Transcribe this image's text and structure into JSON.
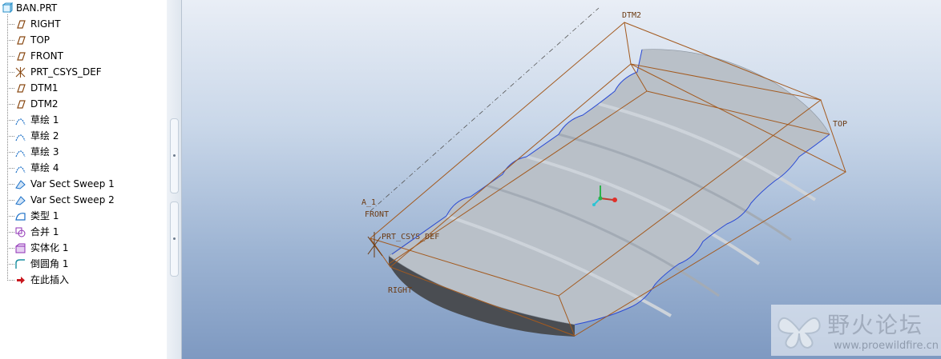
{
  "model_tree": {
    "root": "BAN.PRT",
    "items": [
      {
        "label": "RIGHT",
        "icon": "datum-plane-icon"
      },
      {
        "label": "TOP",
        "icon": "datum-plane-icon"
      },
      {
        "label": "FRONT",
        "icon": "datum-plane-icon"
      },
      {
        "label": "PRT_CSYS_DEF",
        "icon": "coordinate-system-icon"
      },
      {
        "label": "DTM1",
        "icon": "datum-plane-icon"
      },
      {
        "label": "DTM2",
        "icon": "datum-plane-icon"
      },
      {
        "label": "草绘 1",
        "icon": "sketch-icon"
      },
      {
        "label": "草绘 2",
        "icon": "sketch-icon"
      },
      {
        "label": "草绘 3",
        "icon": "sketch-icon"
      },
      {
        "label": "草绘 4",
        "icon": "sketch-icon"
      },
      {
        "label": "Var Sect Sweep 1",
        "icon": "sweep-icon"
      },
      {
        "label": "Var Sect Sweep 2",
        "icon": "sweep-icon"
      },
      {
        "label": "类型 1",
        "icon": "style-icon"
      },
      {
        "label": "合并 1",
        "icon": "merge-icon"
      },
      {
        "label": "实体化 1",
        "icon": "solidify-icon"
      },
      {
        "label": "倒圆角 1",
        "icon": "round-icon"
      },
      {
        "label": "在此插入",
        "icon": "insert-here-arrow-icon"
      }
    ]
  },
  "viewport": {
    "datum_labels": {
      "dtm2": "DTM2",
      "top": "TOP",
      "front": "FRONT",
      "right": "RIGHT",
      "axis": "A_1",
      "csys": "PRT_CSYS_DEF"
    },
    "colors": {
      "datum_outline": "#a35a1f",
      "surface": "#b9c0c8",
      "edge": "#2b4bd6",
      "shadow": "#4a4d52"
    }
  },
  "watermark": {
    "title": "野火论坛",
    "url": "www.proewildfire.cn"
  }
}
